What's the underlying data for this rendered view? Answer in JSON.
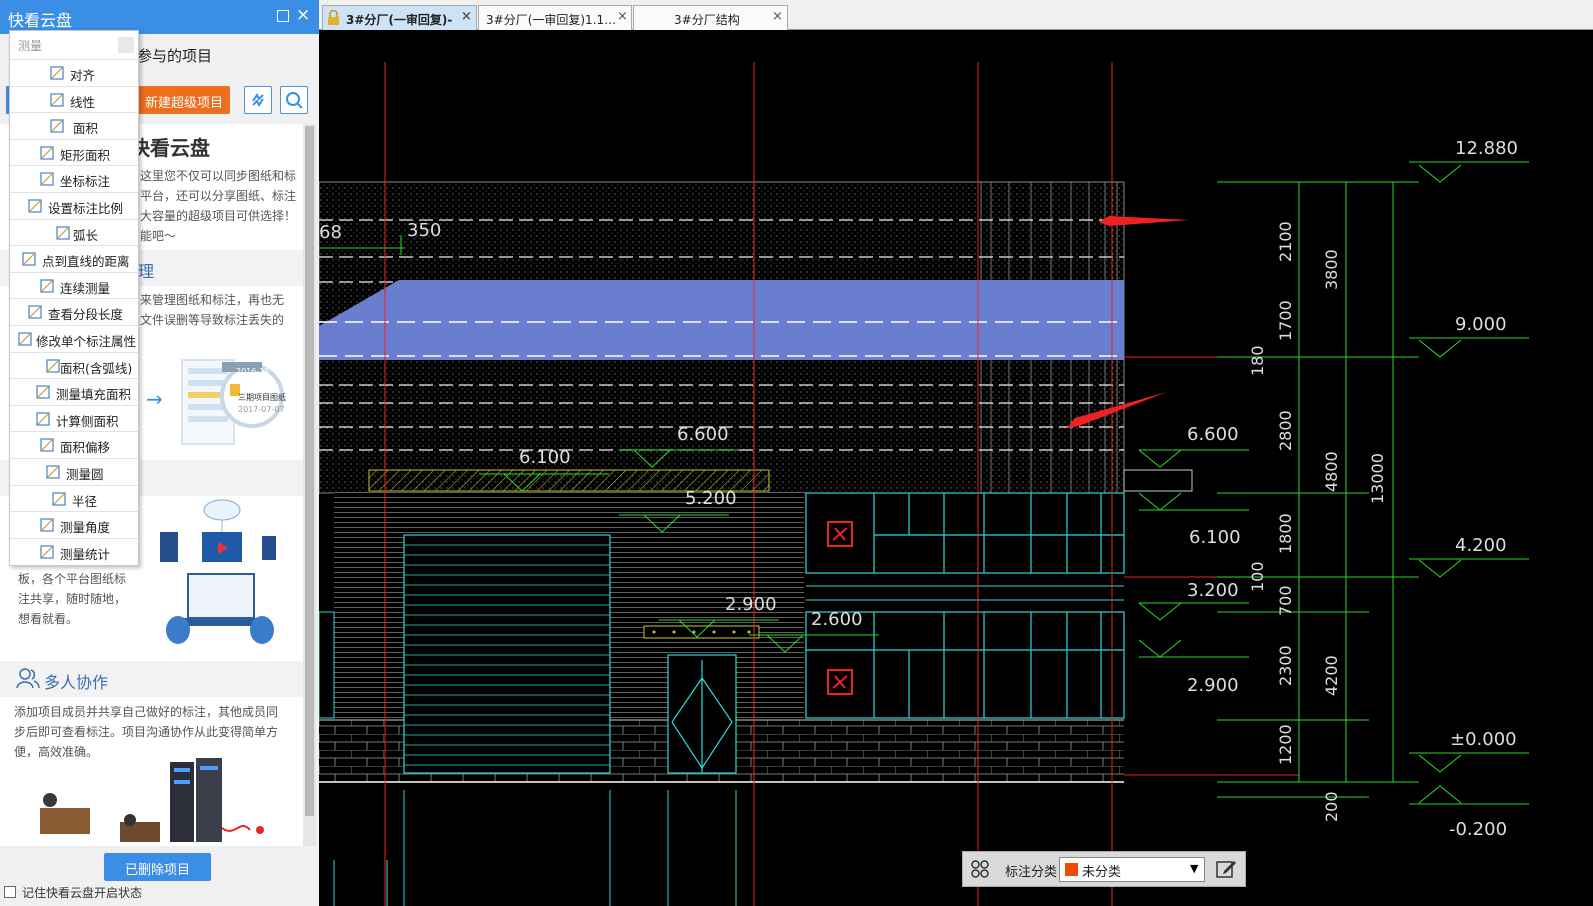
{
  "panel": {
    "title": "快看云盘",
    "subtitle": "参与的项目",
    "new_super_project": "新建超级项目",
    "deleted_projects": "已删除项目",
    "remember_label": "记住快看云盘开启状态"
  },
  "measure_menu": {
    "header": "测量",
    "items": [
      "对齐",
      "线性",
      "面积",
      "矩形面积",
      "坐标标注",
      "设置标注比例",
      "弧长",
      "点到直线的距离",
      "连续测量",
      "查看分段长度",
      "修改单个标注属性",
      "面积(含弧线)",
      "测量填充面积",
      "计算侧面积",
      "面积偏移",
      "测量圆",
      "半径",
      "测量角度",
      "测量统计"
    ]
  },
  "intro": {
    "heading": "快看云盘",
    "lines": [
      "这里您不仅可以同步图纸和标",
      "平台，还可以分享图纸、标注",
      "大容量的超级项目可供选择！",
      "能吧～"
    ],
    "sec2_title": "理",
    "sec2_lines": [
      "来管理图纸和标注，再也无",
      "文件误删等导致标注丢失的"
    ],
    "promo_date_a": "2016-11",
    "promo_folder": "三期项目图纸",
    "promo_date_b": "2017-07-07",
    "sec3_lines": [
      "板，各个平台图纸标",
      "注共享，随时随地，",
      "想看就看。"
    ],
    "collab_title": "多人协作",
    "collab_lines": [
      "添加项目成员并共享自己做好的标注，其他成员同",
      "步后即可查看标注。项目沟通协作从此变得简单方",
      "便，高效准确。"
    ]
  },
  "tabs": [
    {
      "label": "3#分厂(一审回复)-",
      "active": true
    },
    {
      "label": "3#分厂(一审回复)1.1…",
      "active": false
    },
    {
      "label": "3#分厂结构",
      "active": false
    }
  ],
  "drawing": {
    "texts": {
      "t68": "68",
      "t350": "350",
      "e6600a": "6.600",
      "e6100a": "6.100",
      "e5200": "5.200",
      "e2900a": "2.900",
      "e2600": "2.600",
      "r12880": "12.880",
      "r9000": "9.000",
      "r6600": "6.600",
      "r6100": "6.100",
      "r3200": "3.200",
      "r4200": "4.200",
      "r2900": "2.900",
      "r0000": "±0.000",
      "rm0200": "-0.200",
      "d2100": "2100",
      "d1700": "1700",
      "d180": "180",
      "d2800": "2800",
      "d1800": "1800",
      "d100": "100",
      "d700": "700",
      "d2300": "2300",
      "d1200": "1200",
      "d200": "200",
      "d3800": "3800",
      "d4800": "4800",
      "d4200": "4200",
      "d13000": "13000"
    }
  },
  "anno_bar": {
    "label": "标注分类",
    "value": "未分类",
    "swatch_color": "#ee4b0a"
  }
}
